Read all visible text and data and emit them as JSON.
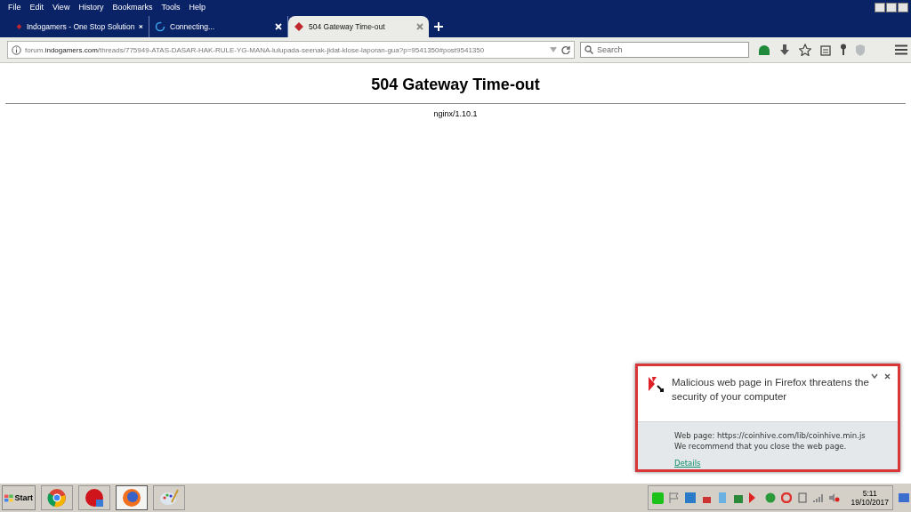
{
  "menu": [
    "File",
    "Edit",
    "View",
    "History",
    "Bookmarks",
    "Tools",
    "Help"
  ],
  "tabs": [
    {
      "label": "Indogamers - One Stop Solution",
      "kind": "site",
      "selected": false
    },
    {
      "label": "Connecting...",
      "kind": "loading",
      "selected": false
    },
    {
      "label": "504 Gateway Time-out",
      "kind": "site",
      "selected": true
    }
  ],
  "address": {
    "prefix": "forum.",
    "domain": "indogamers.com",
    "path": "/threads/775949-ATAS-DASAR-HAK-RULE-YG-MANA-lulupada-seenak-jidat-klose-laporan-gua?p=9541350#post9541350"
  },
  "search": {
    "placeholder": "Search"
  },
  "page": {
    "heading": "504 Gateway Time-out",
    "server": "nginx/1.10.1"
  },
  "alert": {
    "title": "Malicious web page in Firefox threatens the security of your computer",
    "lines": [
      "Web page: https://coinhive.com/lib/coinhive.min.js",
      "We recommend that you close the web page."
    ],
    "link": "Details"
  },
  "taskbar": {
    "start": "Start",
    "apps": [
      {
        "kind": "chrome",
        "selected": false
      },
      {
        "kind": "red",
        "selected": false
      },
      {
        "kind": "firefox",
        "selected": true
      },
      {
        "kind": "paint",
        "selected": false
      }
    ],
    "time": "5:11",
    "date": "19/10/2017"
  }
}
